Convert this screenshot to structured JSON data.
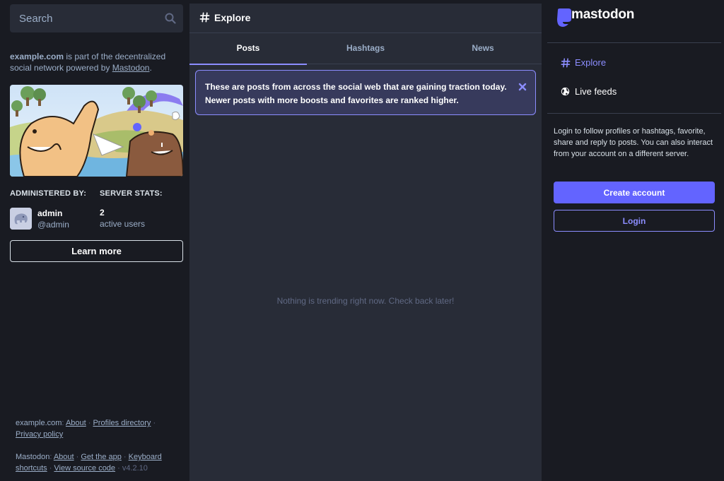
{
  "search": {
    "placeholder": "Search",
    "icon": "search-icon"
  },
  "server_info": {
    "domain": "example.com",
    "desc_middle": " is part of the decentralized social network powered by ",
    "powered_by": "Mastodon",
    "desc_end": "."
  },
  "admin": {
    "heading": "ADMINISTERED BY:",
    "name": "admin",
    "handle": "@admin"
  },
  "stats": {
    "heading": "SERVER STATS:",
    "count": "2",
    "label": "active users"
  },
  "learn_more": "Learn more",
  "footer": {
    "server_label": "example.com",
    "server_links": [
      "About",
      "Profiles directory",
      "Privacy policy"
    ],
    "app_label": "Mastodon",
    "app_links": [
      "About",
      "Get the app",
      "Keyboard shortcuts",
      "View source code"
    ],
    "version": "v4.2.10"
  },
  "column": {
    "title": "Explore",
    "tabs": [
      {
        "label": "Posts",
        "active": true
      },
      {
        "label": "Hashtags",
        "active": false
      },
      {
        "label": "News",
        "active": false
      }
    ],
    "banner": "These are posts from across the social web that are gaining traction today. Newer posts with more boosts and favorites are ranked higher.",
    "empty": "Nothing is trending right now. Check back later!"
  },
  "sidebar": {
    "logo_text": "mastodon",
    "nav": [
      {
        "label": "Explore",
        "icon": "hashtag-icon"
      },
      {
        "label": "Live feeds",
        "icon": "globe-icon"
      }
    ],
    "login_text": "Login to follow profiles or hashtags, favorite, share and reply to posts. You can also interact from your account on a different server.",
    "create_account": "Create account",
    "login": "Login"
  },
  "colors": {
    "background": "#191b22",
    "panel": "#282c37",
    "accent": "#8c8dff",
    "primary_button": "#6364ff",
    "banner_bg": "#373a5c",
    "muted_text": "#9baec8"
  }
}
